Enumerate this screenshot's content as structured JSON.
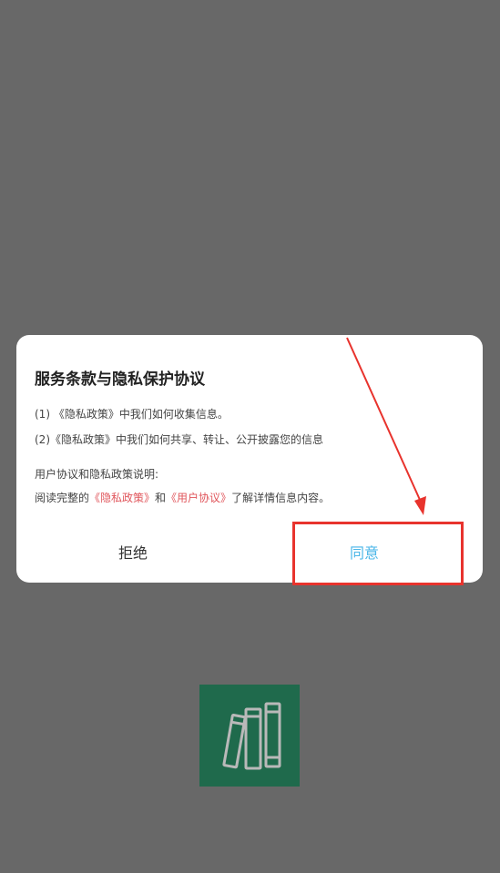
{
  "dialog": {
    "title": "服务条款与隐私保护协议",
    "line1": "(1) 《隐私政策》中我们如何收集信息。",
    "line2": "(2)《隐私政策》中我们如何共享、转让、公开披露您的信息",
    "line3": "用户协议和隐私政策说明:",
    "line4_prefix": "阅读完整的",
    "line4_link1": "《隐私政策》",
    "line4_mid": "和",
    "line4_link2": "《用户协议》",
    "line4_suffix": "了解详情信息内容。",
    "reject_label": "拒绝",
    "agree_label": "同意"
  },
  "colors": {
    "overlay": "#686868",
    "link": "#e0555b",
    "agree": "#4ab6e8",
    "annotation": "#e8332d",
    "logo_bg": "#1f6a4c"
  },
  "icons": {
    "logo": "books-logo-icon",
    "annotation_arrow": "arrow-annotation"
  }
}
